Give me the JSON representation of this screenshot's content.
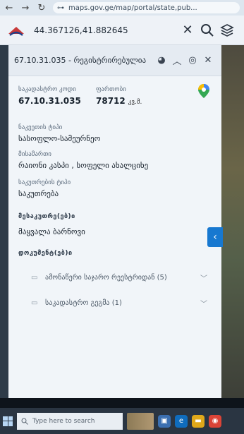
{
  "browser": {
    "back_icon": "arrow-left-icon",
    "forward_icon": "arrow-right-icon",
    "reload_icon": "reload-icon",
    "url": "maps.gov.ge/map/portal/state,pub..."
  },
  "header": {
    "coordinates": "44.367126,41.882645",
    "close_icon": "close-icon",
    "search_icon": "search-icon",
    "layers_icon": "layers-icon"
  },
  "panel": {
    "title": "67.10.31.035 - რეგისტრირებულია",
    "cadastral_code_label": "საკადასტრო კოდი",
    "cadastral_code": "67.10.31.035",
    "area_label": "ფართობი",
    "area_value": "78712",
    "area_unit": "კვ.მ.",
    "land_type_label": "ნაკვეთის ტიპი",
    "land_type": "სასოფლო-სამეურნეო",
    "address_label": "მისამართი",
    "address": "რაიონი კასპი , სოფელი ახალციხე",
    "ownership_label": "საკუთრების ტიპი",
    "ownership": "საკუთრება",
    "owners_title": "მესაკუთრე(ებ)ი",
    "owner_name": "მაყვალა ბარნოვი",
    "documents_title": "დოკუმენტ(ებ)ი",
    "documents": [
      {
        "label": "ამონაწერი საჯარო რეესტრიდან (5)"
      },
      {
        "label": "საკადასტრო გეგმა (1)"
      }
    ]
  },
  "taskbar": {
    "search_placeholder": "Type here to search"
  },
  "colors": {
    "accent": "#1778d0",
    "panel_bg": "#f1f5f9"
  }
}
